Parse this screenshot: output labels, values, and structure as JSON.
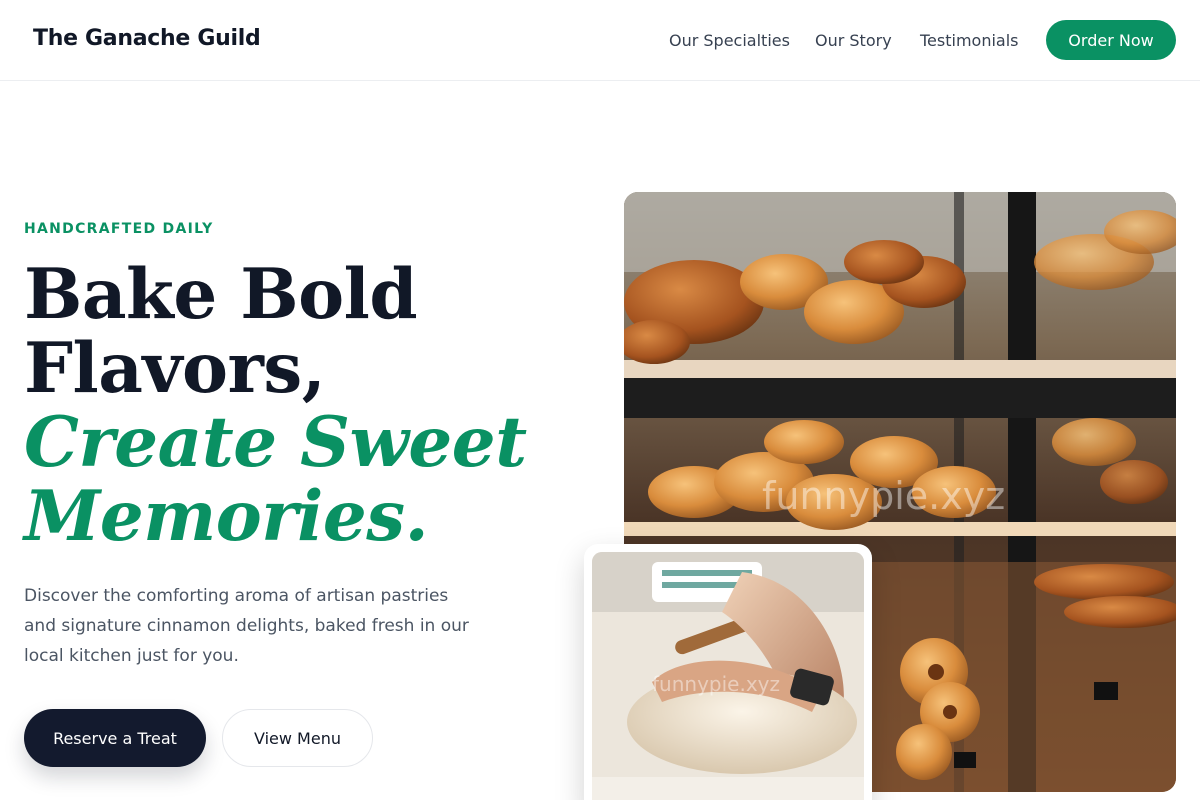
{
  "header": {
    "brand": "The Ganache Guild",
    "nav": [
      {
        "label": "Our Specialties"
      },
      {
        "label": "Our Story"
      },
      {
        "label": "Testimonials"
      }
    ],
    "cta_label": "Order Now"
  },
  "hero": {
    "eyebrow": "HANDCRAFTED DAILY",
    "headline_lines": [
      "Bake Bold",
      "Flavors,"
    ],
    "headline_accent_lines": [
      "Create Sweet",
      "Memories."
    ],
    "description": "Discover the comforting aroma of artisan pastries and signature cinnamon delights, baked fresh in our local kitchen just for you.",
    "primary_button": "Reserve a Treat",
    "secondary_button": "View Menu"
  },
  "images": {
    "main_watermark": "funnypie.xyz",
    "inset_watermark": "funnypie.xyz"
  },
  "colors": {
    "accent": "#0a9163",
    "dark": "#131a2e",
    "text": "#111827",
    "muted": "#4b5563"
  }
}
